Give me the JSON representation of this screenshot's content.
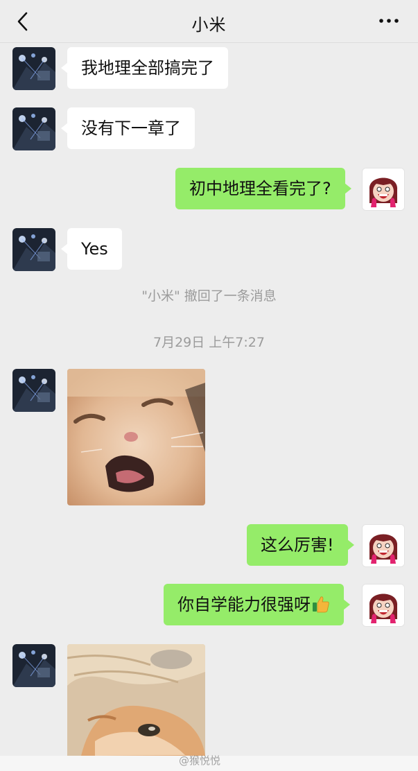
{
  "header": {
    "title": "小米",
    "back_icon": "chevron-left-icon",
    "more_icon": "more-dots-icon"
  },
  "messages": [
    {
      "from": "contact",
      "type": "text",
      "text": "我地理全部搞完了"
    },
    {
      "from": "contact",
      "type": "text",
      "text": "没有下一章了"
    },
    {
      "from": "me",
      "type": "text",
      "text": "初中地理全看完了?"
    },
    {
      "from": "contact",
      "type": "text",
      "text": "Yes"
    },
    {
      "type": "system",
      "text": "\"小米\" 撤回了一条消息"
    },
    {
      "type": "timestamp",
      "text": "7月29日 上午7:27"
    },
    {
      "from": "contact",
      "type": "image",
      "image": "laughing-cat-photo"
    },
    {
      "from": "me",
      "type": "text",
      "text": "这么厉害!"
    },
    {
      "from": "me",
      "type": "text",
      "text": "你自学能力很强呀",
      "emoji": "thumbs-up-emoji"
    },
    {
      "from": "contact",
      "type": "image",
      "image": "cat-under-blanket-photo"
    }
  ],
  "watermark": "@猴悦悦",
  "colors": {
    "background": "#ededed",
    "incoming_bubble": "#ffffff",
    "outgoing_bubble": "#95ec69",
    "system_text": "#9b9b9b"
  }
}
